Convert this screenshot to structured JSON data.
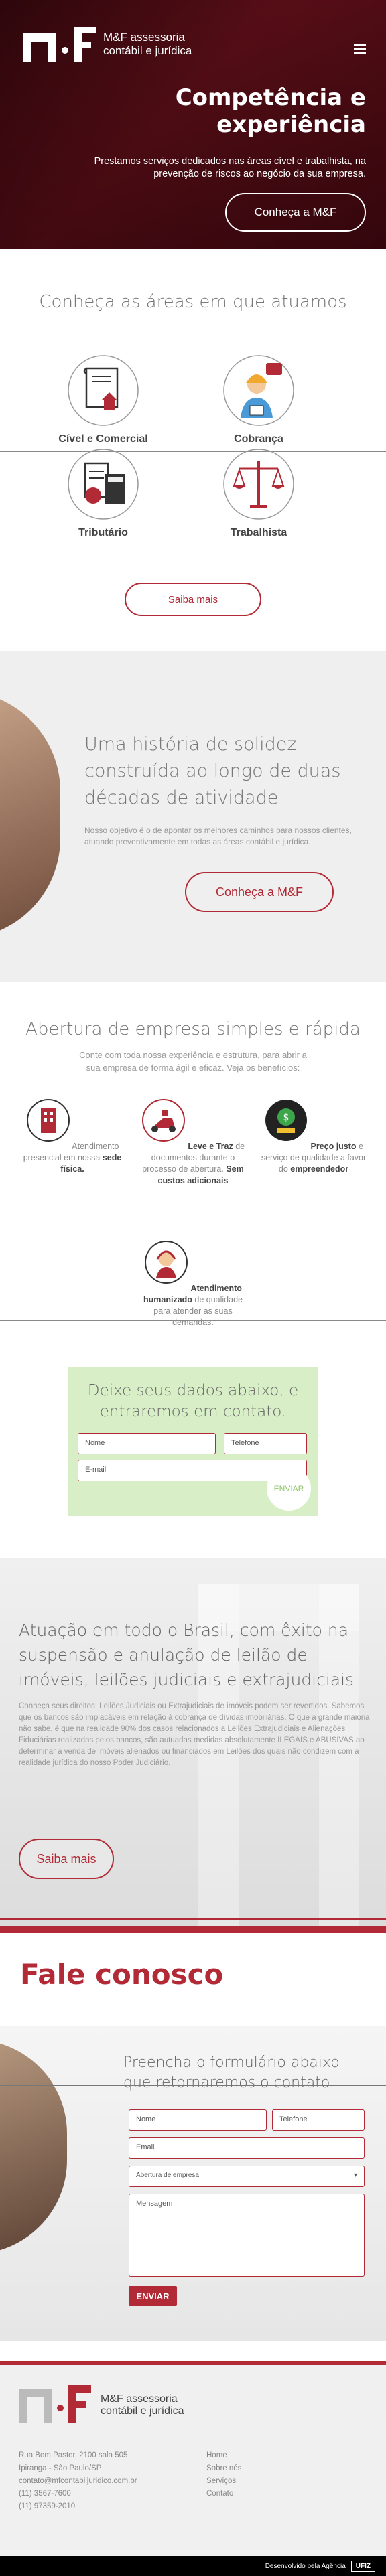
{
  "brand": {
    "line1": "M&F assessoria",
    "line2": "contábil e jurídica",
    "colors": {
      "primary": "#b12a35",
      "green": "#d8eec6"
    }
  },
  "hero": {
    "title": "Competência e experiência",
    "subtitle": "Prestamos serviços dedicados nas áreas cível e trabalhista, na prevenção de riscos ao negócio da sua empresa.",
    "button": "Conheça a M&F"
  },
  "areas": {
    "title": "Conheça as áreas em que atuamos",
    "items": [
      {
        "label": "Cível e Comercial",
        "icon": "document-house-icon"
      },
      {
        "label": "Cobrança",
        "icon": "support-agent-icon"
      },
      {
        "label": "Tributário",
        "icon": "calculator-icon"
      },
      {
        "label": "Trabalhista",
        "icon": "scales-icon"
      }
    ],
    "button": "Saiba mais"
  },
  "historia": {
    "title": "Uma história de solidez construída ao longo de duas décadas de atividade",
    "text": "Nosso objetivo é o de apontar os melhores caminhos para nossos clientes, atuando preventivamente em todas as áreas contábil e jurídica.",
    "button": "Conheça a M&F"
  },
  "abertura": {
    "title": "Abertura de empresa simples e rápida",
    "desc": "Conte com toda nossa experiência e estrutura, para abrir a sua empresa de forma ágil e eficaz. Veja os benefícios:",
    "features": [
      {
        "pre": "Atendimento presencial em nossa ",
        "bold": "sede física.",
        "post": ""
      },
      {
        "pre": "",
        "bold": "Leve e Traz",
        "post": " de documentos durante o processo de abertura. ",
        "bold2": "Sem custos adicionais"
      },
      {
        "pre": "",
        "bold": "Preço justo",
        "post": " e serviço de qualidade a favor do ",
        "bold2": "empreendedor"
      },
      {
        "pre": "",
        "bold": "Atendimento humanizado",
        "post": " de qualidade para atender as suas demandas."
      }
    ],
    "form": {
      "title": "Deixe seus dados abaixo, e entraremos em contato.",
      "nome": "Nome",
      "telefone": "Telefone",
      "email": "E-mail",
      "submit": "ENVIAR"
    }
  },
  "leilao": {
    "title": "Atuação em todo o Brasil, com êxito na suspensão e anulação de leilão de imóveis, leilões judiciais e extrajudiciais",
    "text": "Conheça seus direitos: Leilões Judiciais ou Extrajudiciais de imóveis podem ser revertidos. Sabemos que os bancos são implacáveis em relação à cobrança de dívidas imobiliárias. O que a grande maioria não sabe, é que na realidade 90% dos casos relacionados a Leilões Extrajudiciais e Alienações Fiduciárias realizadas pelos bancos, são autuadas medidas absolutamente ILEGAIS e ABUSIVAS ao determinar a venda de imóveis alienados ou financiados em Leilões dos quais não condizem com a realidade jurídica do nosso Poder Judiciário.",
    "button": "Saiba mais"
  },
  "fale": {
    "title": "Fale conosco",
    "form_title": "Preencha o formulário abaixo que retornaremos o contato.",
    "nome": "Nome",
    "telefone": "Telefone",
    "email": "Email",
    "select": "Abertura de empresa",
    "mensagem": "Mensagem",
    "submit": "ENVIAR"
  },
  "footer": {
    "address": [
      "Rua Bom Pastor, 2100 sala 505",
      "Ipiranga - São Paulo/SP",
      "contato@mfcontabiljuridico.com.br",
      "(11) 3567-7600",
      "(11) 97359-2010"
    ],
    "menu": [
      "Home",
      "Sobre nós",
      "Serviços",
      "Contato"
    ],
    "credit": "Desenvolvido pela Agência",
    "agency": "UFIZ"
  }
}
